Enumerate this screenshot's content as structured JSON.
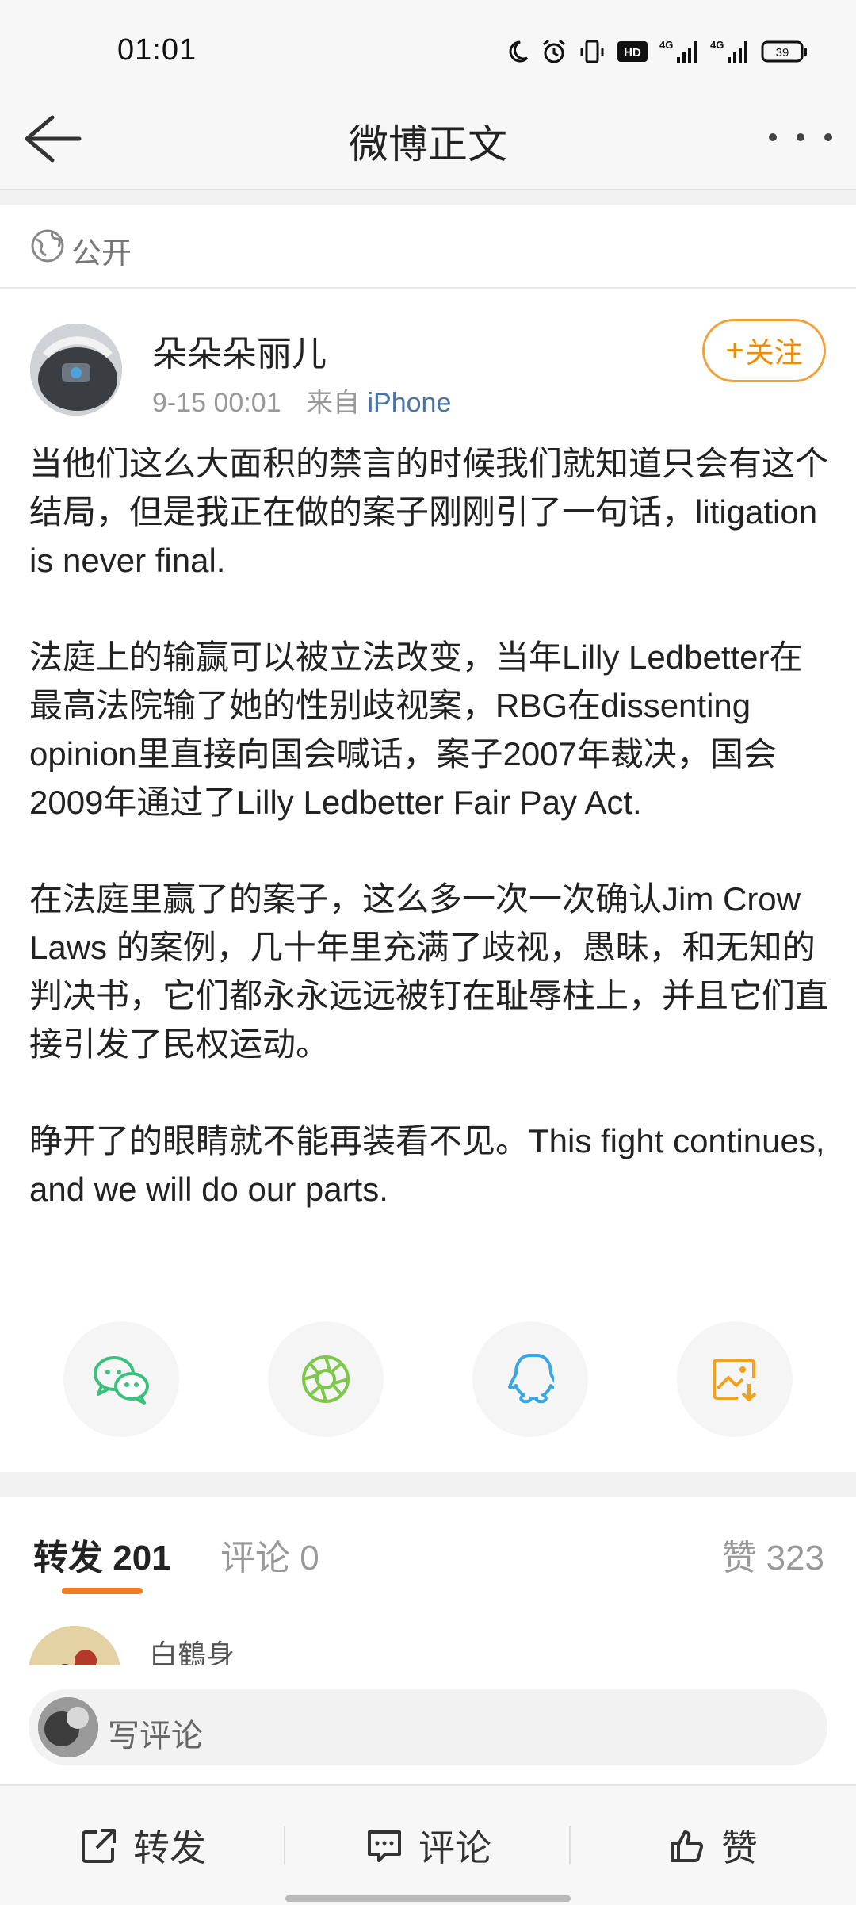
{
  "status_bar": {
    "time": "01:01",
    "battery": "39",
    "net1": "4G",
    "net2": "4G",
    "hd": "HD"
  },
  "nav": {
    "title": "微博正文"
  },
  "visibility": {
    "label": "公开"
  },
  "post": {
    "author": "朵朵朵丽儿",
    "date": "9-15 00:01",
    "source_prefix": "来自",
    "source": "iPhone",
    "follow_label": "关注",
    "paragraphs": [
      "当他们这么大面积的禁言的时候我们就知道只会有这个结局，但是我正在做的案子刚刚引了一句话，litigation is never final.",
      "法庭上的输赢可以被立法改变，当年Lilly Ledbetter在最高法院输了她的性别歧视案，RBG在dissenting opinion里直接向国会喊话，案子2007年裁决，国会2009年通过了Lilly Ledbetter Fair Pay Act.",
      "在法庭里赢了的案子，这么多一次一次确认Jim Crow Laws 的案例，几十年里充满了歧视，愚昧，和无知的判决书，它们都永永远远被钉在耻辱柱上，并且它们直接引发了民权运动。",
      "睁开了的眼睛就不能再装看不见。This fight continues, and we will do our parts."
    ],
    "share_targets": [
      "wechat-icon",
      "moments-icon",
      "qq-icon",
      "save-image-icon"
    ]
  },
  "tabs": {
    "repost": "转发 201",
    "comment": "评论 0",
    "like": "赞 323"
  },
  "reply": {
    "name": "白鶴身"
  },
  "comment_bar": {
    "placeholder": "写评论"
  },
  "actions": {
    "repost": "转发",
    "comment": "评论",
    "like": "赞"
  },
  "colors": {
    "accent": "#f07d25",
    "link": "#4a74a6",
    "wechat": "#3cc07e",
    "moments": "#7dc84a",
    "qq": "#3aa6e6",
    "save": "#f2a21a"
  }
}
